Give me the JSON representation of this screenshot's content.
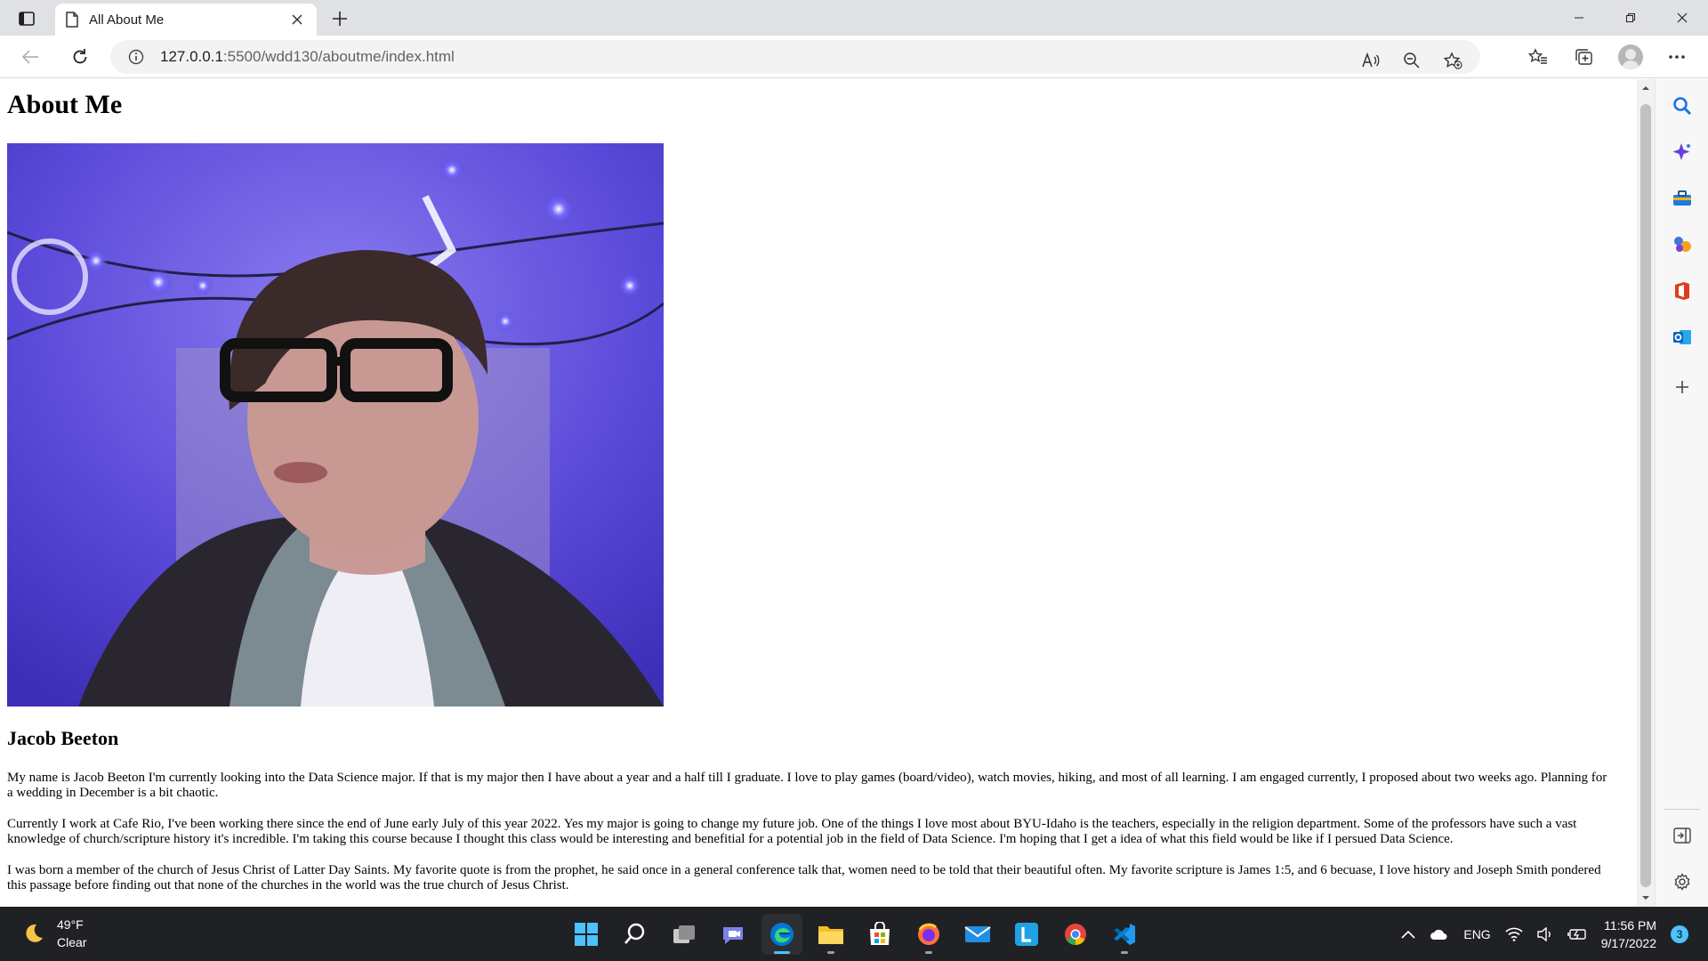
{
  "browser": {
    "tab_title": "All About Me",
    "address_host": "127.0.0.1",
    "address_rest": ":5500/wdd130/aboutme/index.html"
  },
  "page": {
    "heading": "About Me",
    "subheading": "Jacob Beeton",
    "paragraphs": [
      "My name is Jacob Beeton I'm currently looking into the Data Science major. If that is my major then I have about a year and a half till I graduate. I love to play games (board/video), watch movies, hiking, and most of all learning. I am engaged currently, I proposed about two weeks ago. Planning for a wedding in December is a bit chaotic.",
      "Currently I work at Cafe Rio, I've been working there since the end of June early July of this year 2022. Yes my major is going to change my future job. One of the things I love most about BYU-Idaho is the teachers, especially in the religion department. Some of the professors have such a vast knowledge of church/scripture history it's incredible. I'm taking this course because I thought this class would be interesting and benefitial for a potential job in the field of Data Science. I'm hoping that I get a idea of what this field would be like if I persued Data Science.",
      "I was born a member of the church of Jesus Christ of Latter Day Saints. My favorite quote is from the prophet, he said once in a general conference talk that, women need to be told that their beautiful often. My favorite scripture is James 1:5, and 6 becuase, I love history and Joseph Smith pondered this passage before finding out that none of the churches in the world was the true church of Jesus Christ."
    ]
  },
  "taskbar": {
    "temperature": "49°F",
    "condition": "Clear",
    "language": "ENG",
    "time": "11:56 PM",
    "date": "9/17/2022",
    "notifications": "3"
  },
  "icons": {
    "tab_actions": "tab-actions-icon",
    "page": "page-icon",
    "info": "info-icon",
    "read_aloud": "read-aloud-icon",
    "zoom": "zoom-out-icon",
    "favorite_add": "add-favorite-icon",
    "favorites": "favorites-icon",
    "collections": "collections-icon",
    "more": "more-icon"
  },
  "colors": {
    "accent": "#4cc2ff",
    "edge_blue": "#0078d4",
    "photo_bg": "#5a4bd8"
  }
}
